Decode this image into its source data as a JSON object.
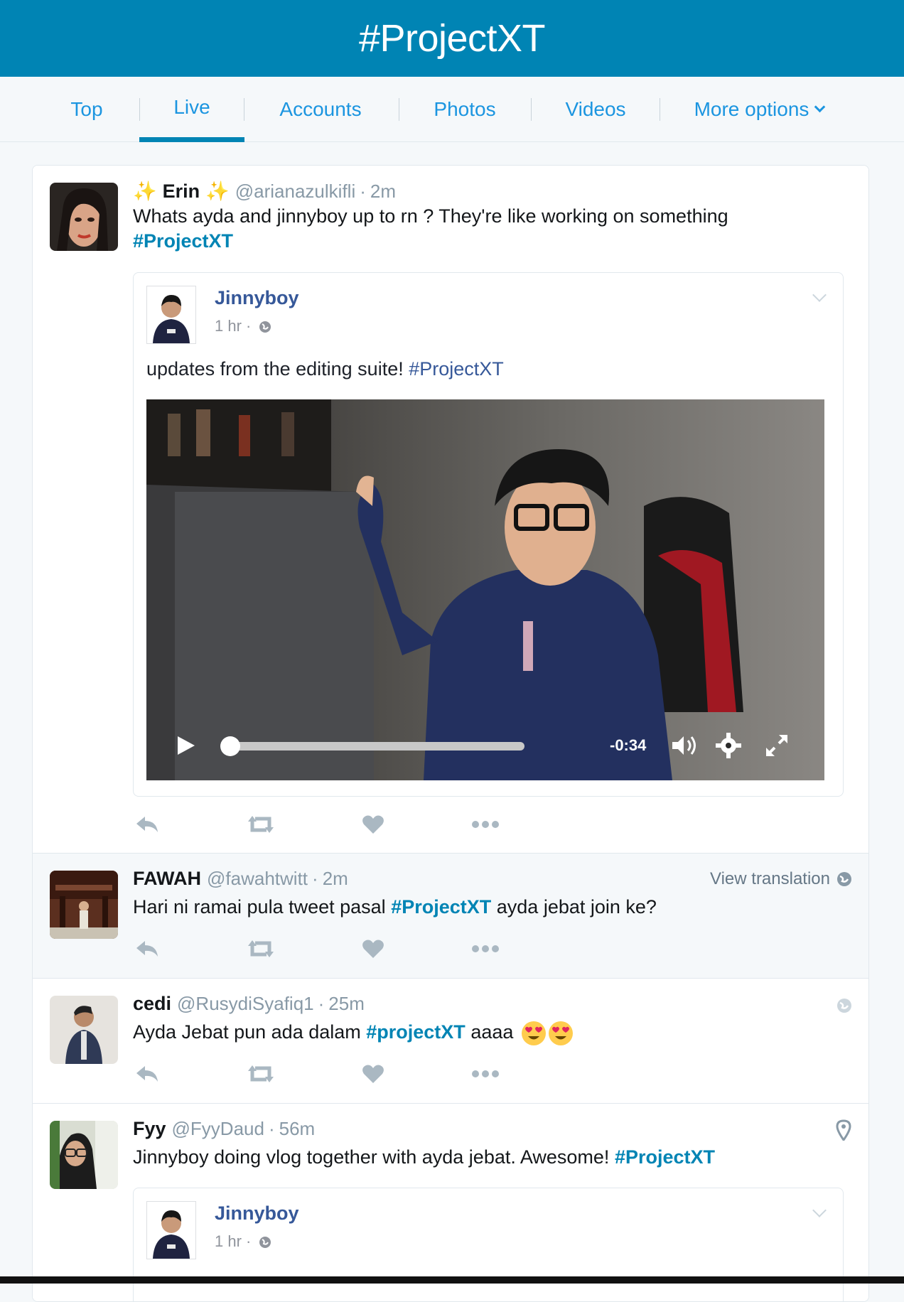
{
  "header": {
    "title": "#ProjectXT"
  },
  "tabs": [
    {
      "label": "Top"
    },
    {
      "label": "Live"
    },
    {
      "label": "Accounts"
    },
    {
      "label": "Photos"
    },
    {
      "label": "Videos"
    },
    {
      "label": "More options"
    }
  ],
  "tweets": [
    {
      "name": "Erin",
      "name_decor": "✨",
      "handle": "@arianazulkifli",
      "sep": "·",
      "time": "2m",
      "text": "Whats ayda and jinnyboy up to rn ? They're like working on something",
      "hashtag": "#ProjectXT",
      "embed": {
        "name": "Jinnyboy",
        "time": "1 hr ·",
        "text": "updates from the editing suite!",
        "tag": "#ProjectXT",
        "video_time": "-0:34"
      }
    },
    {
      "name": "FAWAH",
      "handle": "@fawahtwitt",
      "sep": "·",
      "time": "2m",
      "text_before": "Hari ni ramai pula tweet pasal",
      "hashtag": "#ProjectXT",
      "text_after": "ayda jebat join ke?",
      "view_translation": "View translation"
    },
    {
      "name": "cedi",
      "handle": "@RusydiSyafiq1",
      "sep": "·",
      "time": "25m",
      "text_before": "Ayda Jebat pun ada dalam",
      "hashtag": "#projectXT",
      "text_after": "aaaa"
    },
    {
      "name": "Fyy",
      "handle": "@FyyDaud",
      "sep": "·",
      "time": "56m",
      "text_before": "Jinnyboy doing vlog together with ayda jebat. Awesome!",
      "hashtag": "#ProjectXT",
      "embed": {
        "name": "Jinnyboy",
        "time": "1 hr ·"
      }
    }
  ],
  "colors": {
    "brand": "#0084b4",
    "link": "#1b95e0",
    "muted": "#8899a6"
  }
}
